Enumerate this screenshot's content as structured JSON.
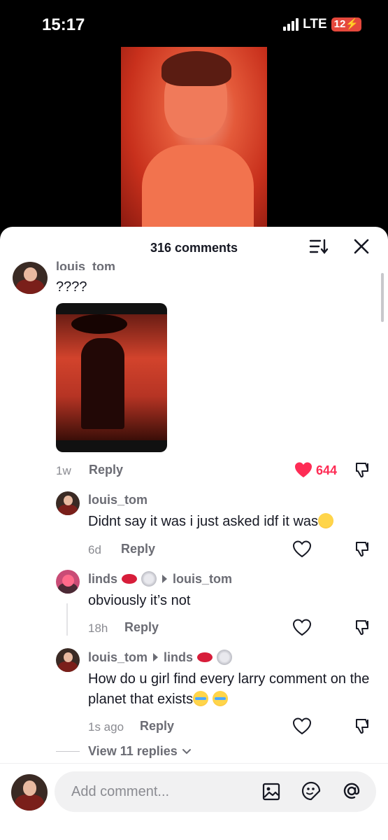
{
  "status_bar": {
    "time": "15:17",
    "network": "LTE",
    "battery": "12"
  },
  "header": {
    "title": "316 comments"
  },
  "comments": [
    {
      "username": "louis_tom",
      "text": "????",
      "age": "1w",
      "reply_label": "Reply",
      "likes": "644",
      "liked": true
    },
    {
      "username": "louis_tom",
      "text": "Didnt say it was i just asked idf it was",
      "age": "6d",
      "reply_label": "Reply"
    },
    {
      "username": "linds",
      "reply_to": "louis_tom",
      "text": "obviously it’s not",
      "age": "18h",
      "reply_label": "Reply"
    },
    {
      "username": "louis_tom",
      "reply_to": "linds",
      "text": "How do u girl find every larry comment on the planet that exists",
      "age": "1s ago",
      "reply_label": "Reply"
    }
  ],
  "view_replies": "View 11 replies",
  "composer": {
    "placeholder": "Add comment..."
  },
  "colors": {
    "accent": "#fe2c55",
    "text": "#161823",
    "muted": "#8a8b91"
  }
}
